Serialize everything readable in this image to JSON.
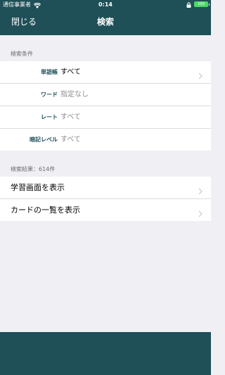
{
  "status_bar": {
    "carrier": "通信事業者",
    "time": "0:14",
    "battery": "100"
  },
  "nav": {
    "close_label": "閉じる",
    "title": "検索"
  },
  "conditions": {
    "header": "検索条件",
    "rows": [
      {
        "label": "単語帳",
        "value": "すべて"
      },
      {
        "label": "ワード",
        "value": "指定なし"
      },
      {
        "label": "レート",
        "value": "すべて"
      },
      {
        "label": "暗記レベル",
        "value": "すべて"
      }
    ]
  },
  "results": {
    "header": "検索結果：614件",
    "rows": [
      {
        "label": "学習画面を表示"
      },
      {
        "label": "カードの一覧を表示"
      }
    ]
  },
  "colors": {
    "accent": "#1f4f57",
    "background": "#efeff4",
    "battery": "#4cd964"
  }
}
